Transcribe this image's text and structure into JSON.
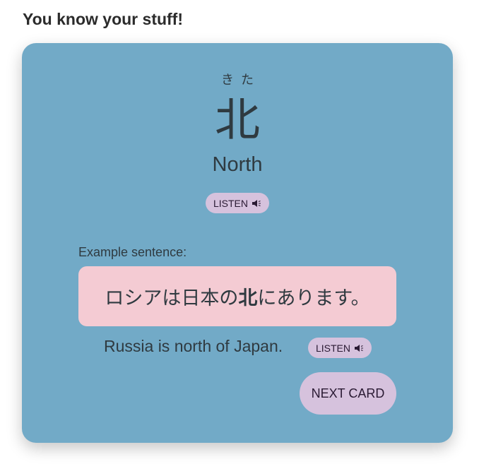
{
  "header": {
    "title": "You know your stuff!"
  },
  "card": {
    "reading": "きた",
    "kanji": "北",
    "meaning": "North",
    "listen_label": "LISTEN",
    "example_label": "Example sentence:",
    "sentence": {
      "before": "ロシアは日本の",
      "highlight": "北",
      "after": "にあります。"
    },
    "translation": "Russia is north of Japan.",
    "sentence_listen_label": "LISTEN",
    "next_label": "NEXT CARD"
  },
  "colors": {
    "card_bg": "#72aac7",
    "sentence_bg": "#f4cbd3",
    "button_bg": "#d6c2dd",
    "text": "#2f3a40"
  },
  "icons": {
    "listen": "speaker-icon"
  }
}
